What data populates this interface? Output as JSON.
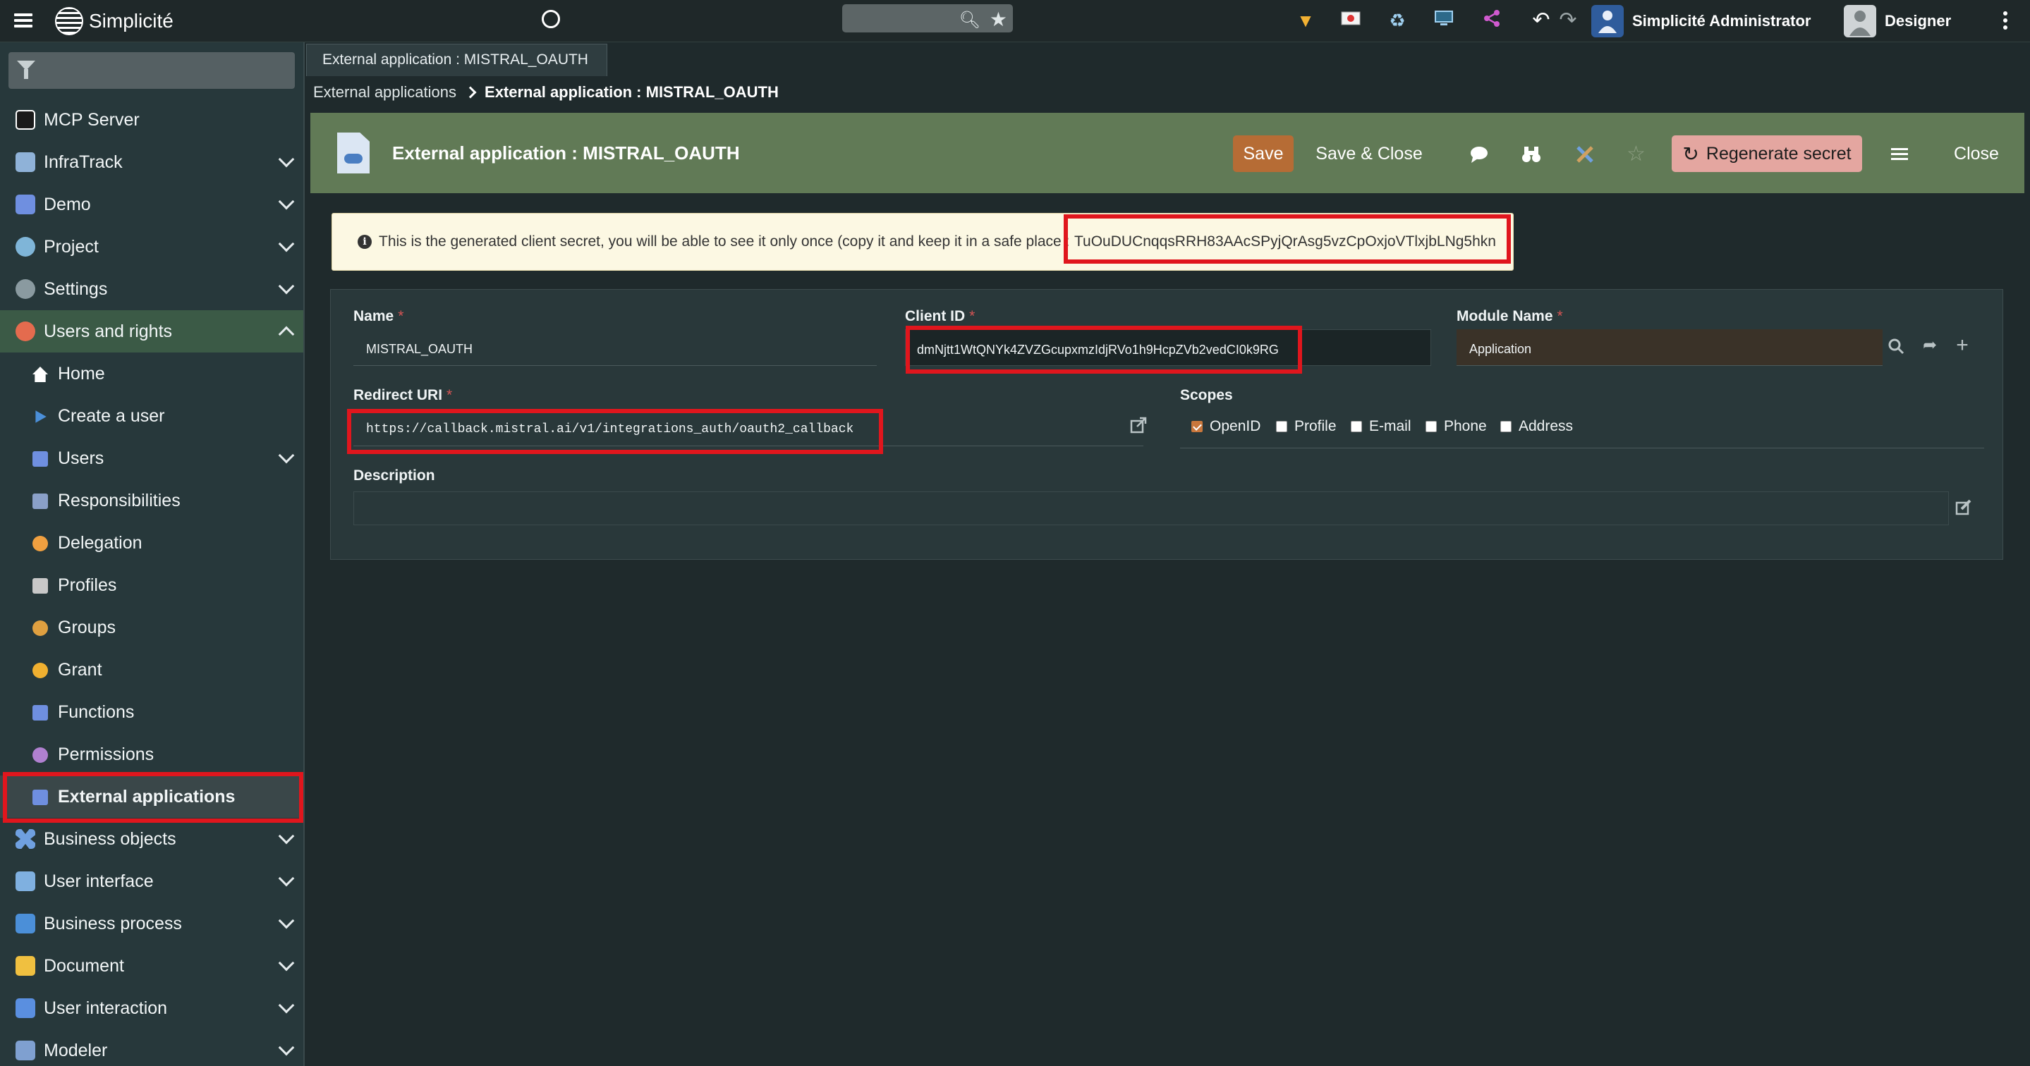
{
  "app": {
    "name": "Simplicité"
  },
  "topbar": {
    "search_placeholder": "",
    "user_name": "Simplicité Administrator",
    "role_name": "Designer",
    "icons": [
      "filter-icon",
      "flag-icon",
      "recycle-icon",
      "monitor-icon",
      "share-icon",
      "undo-icon",
      "redo-icon"
    ]
  },
  "sidebar": {
    "filter_placeholder": "",
    "items": [
      {
        "label": "MCP Server",
        "color": "#ffffff"
      },
      {
        "label": "InfraTrack",
        "color": "#8fb2d8"
      },
      {
        "label": "Demo",
        "color": "#6f8fe0"
      },
      {
        "label": "Project",
        "color": "#7fb5d8"
      },
      {
        "label": "Settings",
        "color": "#8a9aa0"
      },
      {
        "label": "Users and rights",
        "color": "#e46b4e"
      },
      {
        "label": "Home",
        "color": "#ffffff"
      },
      {
        "label": "Create a user",
        "color": "#4b8fd8"
      },
      {
        "label": "Users",
        "color": "#6f8fe0"
      },
      {
        "label": "Responsibilities",
        "color": "#8aa0c8"
      },
      {
        "label": "Delegation",
        "color": "#f0a040"
      },
      {
        "label": "Profiles",
        "color": "#c8c8c8"
      },
      {
        "label": "Groups",
        "color": "#e0a040"
      },
      {
        "label": "Grant",
        "color": "#f0b030"
      },
      {
        "label": "Functions",
        "color": "#6f8fe0"
      },
      {
        "label": "Permissions",
        "color": "#b080d0"
      },
      {
        "label": "External applications",
        "color": "#6f8fe0"
      },
      {
        "label": "Business objects",
        "color": "#6fa0e0"
      },
      {
        "label": "User interface",
        "color": "#7fb0e0"
      },
      {
        "label": "Business process",
        "color": "#4b8fd8"
      },
      {
        "label": "Document",
        "color": "#f0c040"
      },
      {
        "label": "User interaction",
        "color": "#5a8fe0"
      },
      {
        "label": "Modeler",
        "color": "#7fa0d0"
      }
    ]
  },
  "tabs": [
    {
      "label": "External application : MISTRAL_OAUTH"
    }
  ],
  "breadcrumb": {
    "parent": "External applications",
    "current": "External application : MISTRAL_OAUTH"
  },
  "form": {
    "title": "External application : MISTRAL_OAUTH",
    "buttons": {
      "save": "Save",
      "save_close": "Save & Close",
      "regenerate": "Regenerate secret",
      "close": "Close"
    },
    "info_message": "This is the generated client secret, you will be able to see it only once (copy it and keep it in a safe place :",
    "client_secret": "TuOuDUCnqqsRRH83AAcSPyjQrAsg5vzCpOxjoVTlxjbLNg5hkn",
    "fields": {
      "name": {
        "label": "Name",
        "value": "MISTRAL_OAUTH"
      },
      "client_id": {
        "label": "Client ID",
        "value": "dmNjtt1WtQNYk4ZVZGcupxmzIdjRVo1h9HcpZVb2vedCI0k9RG"
      },
      "module_name": {
        "label": "Module Name",
        "value": "Application"
      },
      "redirect_uri": {
        "label": "Redirect URI",
        "value": "https://callback.mistral.ai/v1/integrations_auth/oauth2_callback"
      },
      "scopes": {
        "label": "Scopes",
        "options": [
          {
            "label": "OpenID",
            "checked": true
          },
          {
            "label": "Profile",
            "checked": false
          },
          {
            "label": "E-mail",
            "checked": false
          },
          {
            "label": "Phone",
            "checked": false
          },
          {
            "label": "Address",
            "checked": false
          }
        ]
      },
      "description": {
        "label": "Description",
        "value": ""
      }
    }
  },
  "colors": {
    "header": "#617a56",
    "save": "#b66c35",
    "regenerate": "#e4a6a0",
    "highlight": "#e0161d"
  }
}
